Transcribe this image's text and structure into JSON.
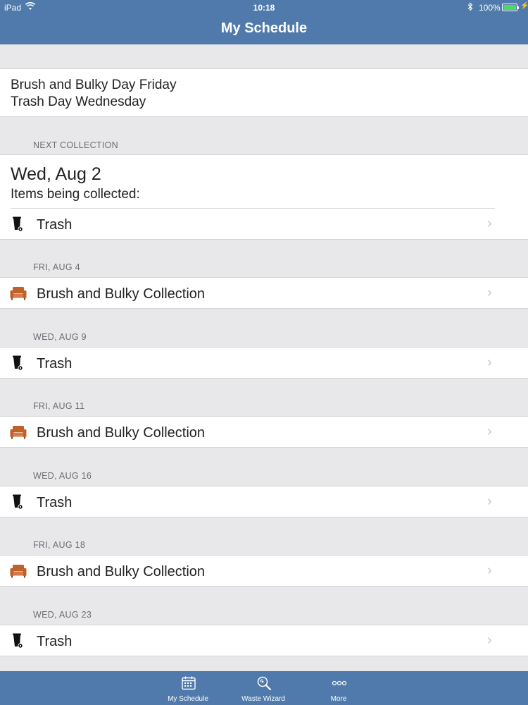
{
  "status_bar": {
    "carrier": "iPad",
    "time": "10:18",
    "battery_pct": "100%",
    "battery_color": "#4cd964"
  },
  "nav": {
    "title": "My Schedule",
    "bar_color": "#4f7aab"
  },
  "summary": {
    "line1": "Brush and Bulky Day Friday",
    "line2": "Trash Day Wednesday"
  },
  "next_collection": {
    "header": "NEXT COLLECTION",
    "date": "Wed, Aug 2",
    "subtitle": "Items being collected:",
    "item": {
      "label": "Trash",
      "icon": "trash-can-icon"
    }
  },
  "schedule": [
    {
      "date": "FRI, AUG 4",
      "label": "Brush and Bulky Collection",
      "icon": "sofa-icon"
    },
    {
      "date": "WED, AUG 9",
      "label": "Trash",
      "icon": "trash-can-icon"
    },
    {
      "date": "FRI, AUG 11",
      "label": "Brush and Bulky Collection",
      "icon": "sofa-icon"
    },
    {
      "date": "WED, AUG 16",
      "label": "Trash",
      "icon": "trash-can-icon"
    },
    {
      "date": "FRI, AUG 18",
      "label": "Brush and Bulky Collection",
      "icon": "sofa-icon"
    },
    {
      "date": "WED, AUG 23",
      "label": "Trash",
      "icon": "trash-can-icon"
    }
  ],
  "tabs": [
    {
      "label": "My Schedule",
      "icon": "calendar-icon"
    },
    {
      "label": "Waste Wizard",
      "icon": "magnifier-icon"
    },
    {
      "label": "More",
      "icon": "more-dots-icon"
    }
  ],
  "icon_colors": {
    "trash": "#111111",
    "sofa": "#c0602a"
  }
}
